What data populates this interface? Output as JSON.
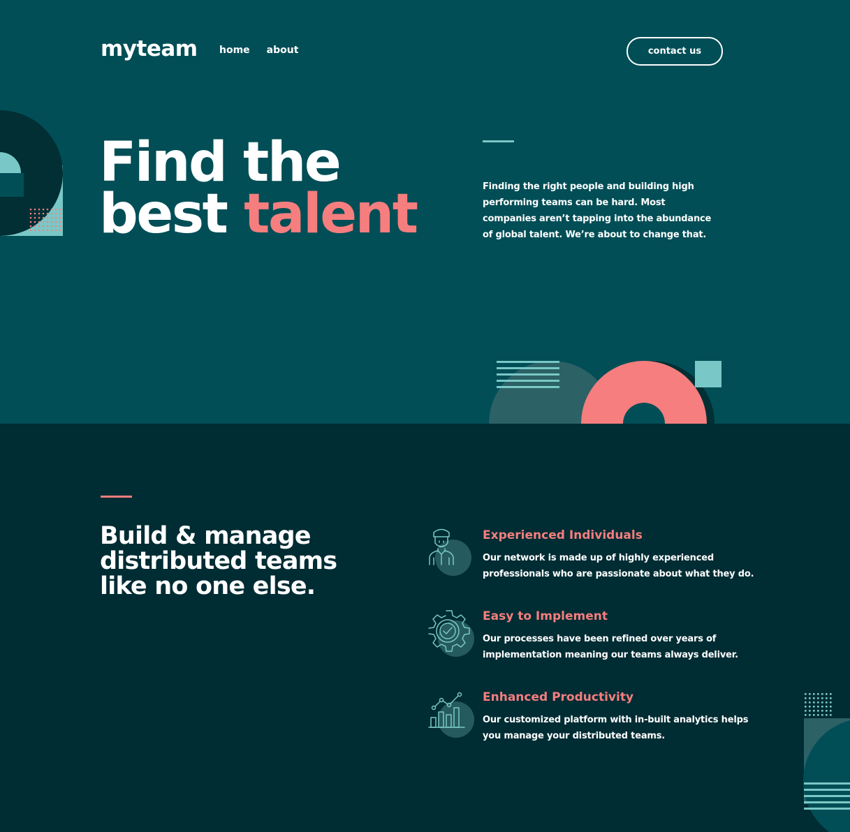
{
  "header": {
    "logo": "myteam",
    "nav": [
      {
        "label": "home"
      },
      {
        "label": "about"
      }
    ],
    "contact_label": "contact us"
  },
  "hero": {
    "title_line1": "Find the",
    "title_line2_plain": "best",
    "title_line2_accent": "talent",
    "description": "Finding the right people and building high performing teams can be hard. Most companies aren’t tapping into the abundance of global talent. We’re about to change that."
  },
  "features": {
    "title": "Build & manage distributed teams like no one else.",
    "items": [
      {
        "icon": "person-icon",
        "heading": "Experienced Individuals",
        "body": "Our network is made up of highly experienced professionals who are passionate about what they do."
      },
      {
        "icon": "cog-check-icon",
        "heading": "Easy to Implement",
        "body": "Our processes have been refined over years of implementation meaning our teams always deliver."
      },
      {
        "icon": "chart-icon",
        "heading": "Enhanced Productivity",
        "body": "Our customized platform with in-built analytics helps you manage your distributed teams."
      }
    ]
  },
  "colors": {
    "hero_bg": "#014e56",
    "features_bg": "#002c33",
    "accent_coral": "#f67e7e",
    "accent_teal": "#79c8c7",
    "text": "#ffffff"
  }
}
